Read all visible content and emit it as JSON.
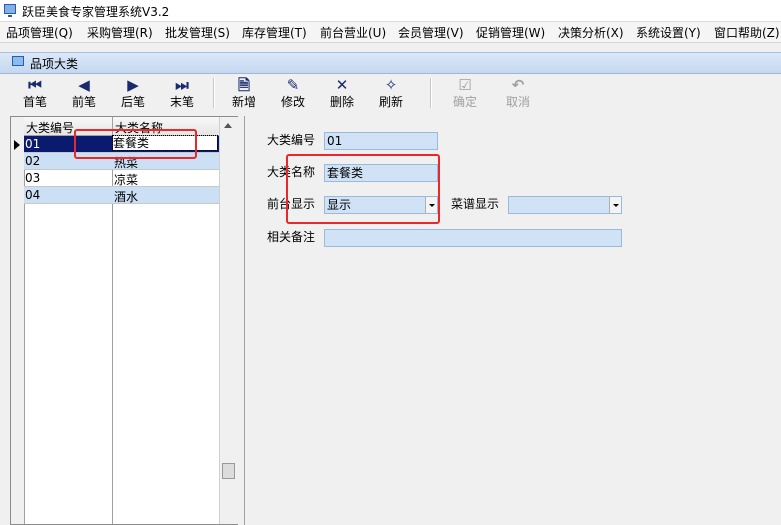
{
  "app": {
    "title": "跃臣美食专家管理系统V3.2"
  },
  "menu": [
    "品项管理(Q)",
    "采购管理(R)",
    "批发管理(S)",
    "库存管理(T)",
    "前台营业(U)",
    "会员管理(V)",
    "促销管理(W)",
    "决策分析(X)",
    "系统设置(Y)",
    "窗口帮助(Z)"
  ],
  "window": {
    "title": "品项大类"
  },
  "toolbar": {
    "first": {
      "label": "首笔",
      "icon": "first-record-icon"
    },
    "prev": {
      "label": "前笔",
      "icon": "prev-record-icon"
    },
    "next": {
      "label": "后笔",
      "icon": "next-record-icon"
    },
    "last": {
      "label": "末笔",
      "icon": "last-record-icon"
    },
    "add": {
      "label": "新增",
      "icon": "add-document-icon"
    },
    "edit": {
      "label": "修改",
      "icon": "eraser-icon"
    },
    "delete": {
      "label": "删除",
      "icon": "delete-x-icon"
    },
    "refresh": {
      "label": "刷新",
      "icon": "broom-icon"
    },
    "confirm": {
      "label": "确定",
      "icon": "check-clipboard-icon",
      "disabled": true
    },
    "cancel": {
      "label": "取消",
      "icon": "undo-icon",
      "disabled": true
    }
  },
  "grid": {
    "columns": [
      "大类编号",
      "大类名称"
    ],
    "rows": [
      {
        "code": "01",
        "name": "套餐类",
        "selected": true
      },
      {
        "code": "02",
        "name": "热菜"
      },
      {
        "code": "03",
        "name": "凉菜"
      },
      {
        "code": "04",
        "name": "酒水"
      }
    ]
  },
  "form": {
    "code_label": "大类编号",
    "code_value": "01",
    "name_label": "大类名称",
    "name_value": "套餐类",
    "front_label": "前台显示",
    "front_value": "显示",
    "menu_label": "菜谱显示",
    "menu_value": "",
    "remark_label": "相关备注",
    "remark_value": ""
  },
  "colors": {
    "highlight_box": "#e8282a",
    "selected_row": "#0a1a6e",
    "alt_row": "#cce0f5",
    "field_bg": "#cfe2f6"
  }
}
